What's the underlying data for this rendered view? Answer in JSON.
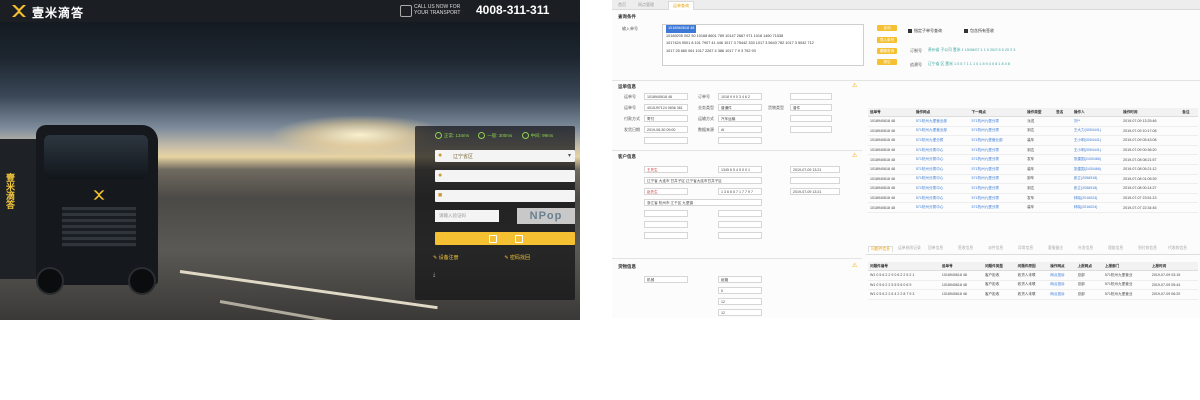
{
  "left_panel": {
    "brand_name": "壹米滴答",
    "call_us": "CALL US NOW FOR YOUR TRANSPORT",
    "hotline": "4008-311-311",
    "truck_brand": "壹米滴答",
    "login": {
      "legend": [
        "正常: 134ms",
        "一般: 300ms",
        "中间: 99ms"
      ],
      "region_value": "辽宁省区",
      "captcha_placeholder": "请输入验证码",
      "captcha_text": "NPop",
      "links": [
        "设备注册",
        "密码找回"
      ]
    }
  },
  "right_panel": {
    "tabs": [
      "首页",
      "网点管理",
      "运单查询"
    ],
    "query_section": {
      "title": "查询条件",
      "input_label": "输入单号",
      "waybills": [
        "1018940618 48",
        "10189205 002 50   10168 8601 789   10147 2667 971   1018 1460 71538",
        "1017424 9001 8   101 7907 41 446   1017 3 75442 333   1017 3 5643 782   1017 3 5042 712",
        "1017 25 660 061   1017 2267 4 386   1017 7 9 3 752 93"
      ],
      "selected_waybill": "1018940618 48",
      "buttons": [
        "查询",
        "导入单号",
        "模糊查询",
        "清空"
      ],
      "checkboxes": [
        "指定子单号查询",
        "包含所有签收"
      ],
      "note_label": "订制号",
      "note_text": "贵州省 子公司 壹米 1 15/08/07 1 1 0 20/2 5 5 20 2 3",
      "ext_label": "追溯号",
      "ext_text": "辽宁省 区 壹米 1 0 5 7 1 1 1 0 1 8 9 4 0 6 1 8 4 8"
    },
    "basic_section": {
      "title": "运单信息",
      "fields": [
        {
          "label": "运单号",
          "value": "1018940618 48"
        },
        {
          "label": "订单号",
          "value": "1018 9 9 0 3 4 6 2"
        },
        {
          "label": "运单号",
          "value": "4015J97124 0836 361"
        },
        {
          "label": "业务类型",
          "value": "普通件"
        },
        {
          "label": "货物类型",
          "value": "普件"
        },
        {
          "label": "付款方式",
          "value": "寄付"
        },
        {
          "label": "发货日期",
          "value": "2019-06-30 09:00"
        },
        {
          "label": "运输方式",
          "value": "汽车运输"
        },
        {
          "label": "数据来源",
          "value": "AI"
        }
      ]
    },
    "customer_section": {
      "title": "客户信息",
      "sender_name": "王先生",
      "sender_phone": "1345 6 5 4 5 0 0 1",
      "sender_addr": "辽宁省 大连市 甘井子区 辽宁省大连市甘井子区",
      "receiver_name": "赵先生",
      "receiver_phone": "1 3 6 6 5 7 1 7 7 9 7",
      "receiver_addr": "浙江省 杭州市 江干区 九堡镇",
      "arrive_time": "2019-07-09 13:21"
    },
    "cargo_section": {
      "title": "货物信息",
      "goods_name": "机械",
      "package": "纸箱",
      "weight": "5",
      "volume": "12",
      "fee": "12"
    },
    "trace_table": {
      "headers": [
        "运单号",
        "操作网点",
        "下一网点",
        "操作类型",
        "签名",
        "操作人",
        "操作时间",
        "备注"
      ],
      "rows": [
        [
          "1018940618 48",
          "571杭州九堡营业部",
          "571杭州九堡分拨",
          "派送",
          "",
          "刘**",
          "2019-07-09 13:25:46",
          ""
        ],
        [
          "1018940618 48",
          "571杭州九堡营业部",
          "571杭州九堡分拨",
          "到达",
          "",
          "王大力(3054441)",
          "2019-07-09 10:17:08",
          ""
        ],
        [
          "1018940618 48",
          "571杭州九堡分拨",
          "571杭州九堡营业部",
          "装车",
          "",
          "王小明(3054441)",
          "2019-07-09 05:43:08",
          ""
        ],
        [
          "1018940618 48",
          "571杭州分拨中心",
          "571杭州九堡分拨",
          "到达",
          "",
          "王小明(3054441)",
          "2019-07-09 00:36:20",
          ""
        ],
        [
          "1018940618 48",
          "571杭州分拨中心",
          "571杭州九堡分拨",
          "发车",
          "",
          "张建国(2430466)",
          "2019-07-08 08:21:57",
          ""
        ],
        [
          "1018940618 48",
          "571杭州分拨中心",
          "571杭州九堡分拨",
          "装车",
          "",
          "张建国(2430466)",
          "2019-07-08 05:21:12",
          ""
        ],
        [
          "1018940618 48",
          "571杭州分拨中心",
          "571杭州九堡分拨",
          "卸车",
          "",
          "彭立(2058918)",
          "2019-07-08 01:05:39",
          ""
        ],
        [
          "1018940618 48",
          "571杭州分拨中心",
          "571杭州九堡分拨",
          "到达",
          "",
          "彭立(2058918)",
          "2019-07-08 00:14:27",
          ""
        ],
        [
          "1018940618 48",
          "571杭州分拨中心",
          "571杭州九堡分拨",
          "发车",
          "",
          "林晓(2016024)",
          "2019-07-07 23:51:13",
          ""
        ],
        [
          "1018940618 48",
          "571杭州分拨中心",
          "571杭州九堡分拨",
          "装车",
          "",
          "林晓(2016024)",
          "2019-07-07 22:34:45",
          ""
        ]
      ]
    },
    "bottom_tabs": [
      "问题件信息",
      "运单修改记录",
      "回单信息",
      "签收信息",
      "派件信息",
      "异常信息",
      "客服备注",
      "外发信息",
      "理赔信息",
      "到付款信息",
      "代收款信息"
    ],
    "problem_table": {
      "headers": [
        "问题件编号",
        "运单号",
        "问题件类型",
        "问题件原因",
        "操作网点",
        "上报网点",
        "上报部门",
        "上报时间"
      ],
      "rows": [
        [
          "W1 0 5 6 2 2 9 0 6 2 2 5 2 1",
          "1018940618 48",
          "客户拒收",
          "收货人未联",
          "网点投诉",
          "总部",
          "571杭州九堡营业",
          "2019-07-09 03:15"
        ],
        [
          "W1 0 5 6 2 2 5 5 5 6 0 6 9",
          "1018940618 48",
          "客户拒收",
          "收货人未联",
          "网点投诉",
          "总部",
          "571杭州九堡营业",
          "2019-07-09 05:44"
        ],
        [
          "W1 0 5 6 2 2 6 4 2 2 8 7 9 3",
          "1018940618 48",
          "客户拒收",
          "收货人未联",
          "网点投诉",
          "总部",
          "571杭州九堡营业",
          "2019-07-09 06:20"
        ]
      ]
    },
    "colors": {
      "accent": "#f5c031",
      "link": "#3a7bd5",
      "green": "#3aa6a0"
    }
  }
}
